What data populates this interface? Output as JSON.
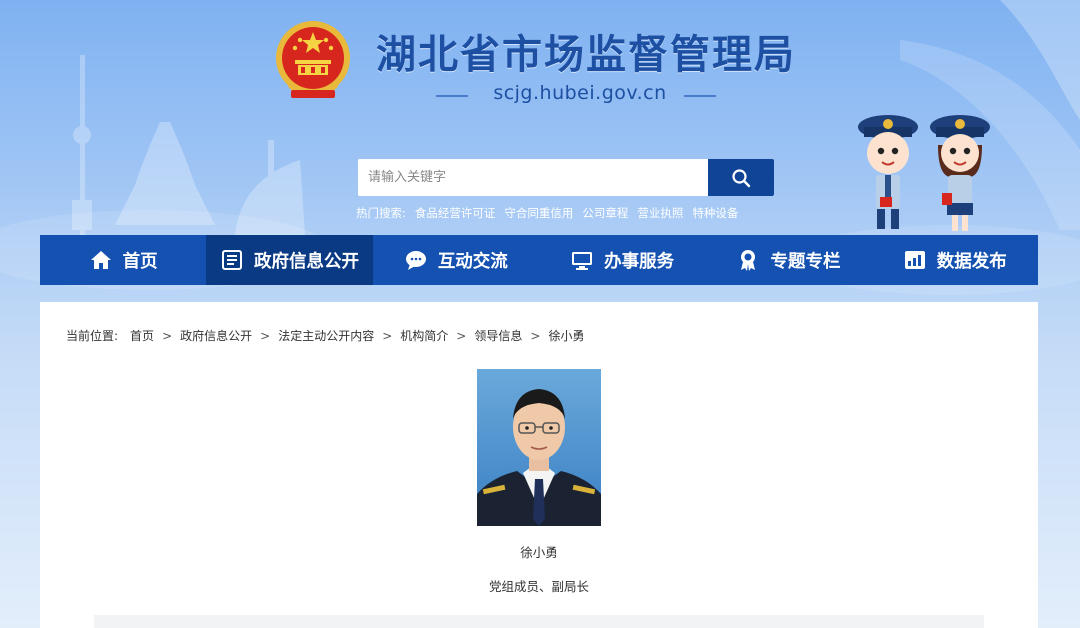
{
  "header": {
    "site_title": "湖北省市场监督管理局",
    "site_domain": "scjg.hubei.gov.cn"
  },
  "search": {
    "placeholder": "请输入关键字",
    "button_icon": "search-icon"
  },
  "hot_search": {
    "label": "热门搜索:",
    "items": [
      "食品经营许可证",
      "守合同重信用",
      "公司章程",
      "营业执照",
      "特种设备"
    ]
  },
  "nav": {
    "items": [
      {
        "label": "首页",
        "icon": "home-icon"
      },
      {
        "label": "政府信息公开",
        "icon": "document-icon",
        "active": true
      },
      {
        "label": "互动交流",
        "icon": "chat-icon"
      },
      {
        "label": "办事服务",
        "icon": "monitor-icon"
      },
      {
        "label": "专题专栏",
        "icon": "ribbon-icon"
      },
      {
        "label": "数据发布",
        "icon": "chart-icon"
      }
    ]
  },
  "breadcrumb": {
    "label": "当前位置:",
    "items": [
      "首页",
      "政府信息公开",
      "法定主动公开内容",
      "机构简介",
      "领导信息",
      "徐小勇"
    ],
    "separator": ">"
  },
  "person": {
    "name": "徐小勇",
    "title": "党组成员、副局长"
  },
  "colors": {
    "nav_bg": "#1451b0",
    "nav_active": "#0b3a84",
    "title_blue": "#1d4fa3",
    "search_btn": "#0f4496"
  }
}
